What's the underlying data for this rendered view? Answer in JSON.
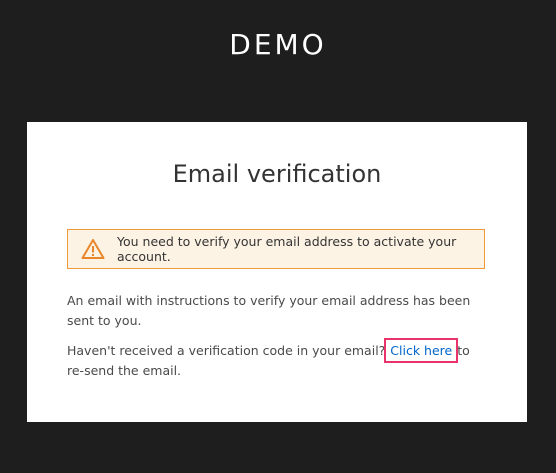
{
  "brand": {
    "title": "DEMO"
  },
  "card": {
    "title": "Email verification",
    "alert": {
      "icon": "warning-triangle-icon",
      "message": "You need to verify your email address to activate your account."
    },
    "instructions": "An email with instructions to verify your email address has been sent to you.",
    "resend": {
      "prefix": "Haven't received a verification code in your email?",
      "link_label": "Click here",
      "suffix": "to re-send the email."
    }
  },
  "colors": {
    "background": "#1e1e1e",
    "card": "#ffffff",
    "alert_border": "#ec9a3c",
    "alert_bg": "#fdf3e5",
    "link": "#0066cc",
    "highlight": "#e8336b"
  }
}
